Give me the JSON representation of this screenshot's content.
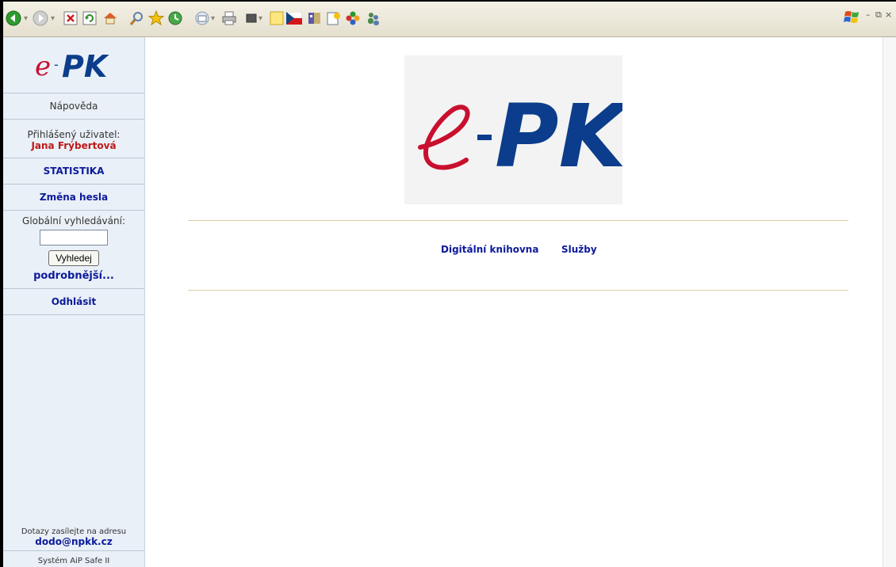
{
  "toolbar": {
    "icons": [
      "back-icon",
      "forward-icon",
      "stop-icon",
      "refresh-icon",
      "home-icon",
      "search-icon",
      "favorites-icon",
      "history-icon",
      "mail-icon",
      "print-icon",
      "edit-icon",
      "notes-icon",
      "flag-czech-icon",
      "book-icon",
      "notepad-icon",
      "flower-icon",
      "users-icon"
    ]
  },
  "sidebar": {
    "logo_text": "e-PK",
    "help": "Nápověda",
    "user_label": "Přihlášený uživatel:",
    "user_name": "Jana Frýbertová",
    "statistics": "STATISTIKA",
    "change_password": "Změna hesla",
    "search_label": "Globální vyhledávání:",
    "search_value": "",
    "search_button": "Vyhledej",
    "advanced": "podrobnější...",
    "logout": "Odhlásit",
    "contact_text": "Dotazy zasílejte na adresu",
    "contact_email": "dodo@npkk.cz",
    "system_text": "Systém AiP Safe II"
  },
  "main": {
    "logo_text": "e-PK",
    "nav": [
      "Digitální knihovna",
      "Služby"
    ]
  },
  "colors": {
    "logo_blue": "#0b3d8c",
    "logo_red": "#c8102e",
    "link_blue": "#0c1a9a",
    "user_red": "#c01818",
    "sidebar_bg": "#e9f0f7"
  }
}
